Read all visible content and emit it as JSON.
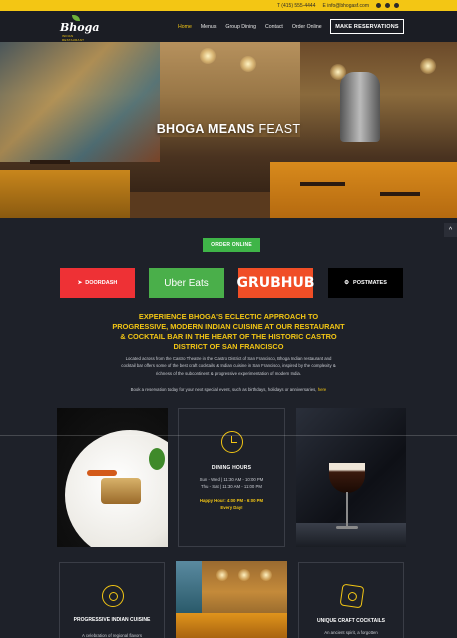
{
  "topbar": {
    "phone": "T (415) 555-4444",
    "email": "E info@bhogasf.com",
    "social_icons": [
      "facebook-icon",
      "instagram-icon",
      "yelp-icon"
    ]
  },
  "nav": {
    "logo_text": "Bhoga",
    "logo_tagline": "INDIAN RESTAURANT",
    "menu": [
      "Home",
      "Menus",
      "Group Dining",
      "Contact",
      "Order Online"
    ],
    "active_item": "Home",
    "reserve_label": "MAKE RESERVATIONS"
  },
  "hero": {
    "title_bold": "BHOGA MEANS",
    "title_light": "FEAST"
  },
  "order_online_label": "ORDER ONLINE",
  "scroll_top_icon": "chevron-up-icon",
  "delivery": {
    "doordash": "DOORDASH",
    "ubereats": "Uber Eats",
    "grubhub": "GRUBHUB",
    "postmates": "POSTMATES"
  },
  "intro": {
    "heading": "EXPERIENCE BHOGA'S ECLECTIC APPROACH TO PROGRESSIVE, MODERN INDIAN CUISINE AT OUR RESTAURANT & COCKTAIL BAR IN THE HEART OF THE HISTORIC CASTRO DISTRICT OF SAN FRANCISCO",
    "body": "Located across from the Castro Theatre in the Castro District of San Francisco, Bhoga Indian restaurant and cocktail bar offers some of the best craft cocktails & Indian cuisine in San Francisco, inspired by the complexity & richness of the subcontinent & progressive experimentation of modern India.",
    "book_text": "Book a reservation today for your next special event, such as birthdays, holidays or anniversaries,",
    "book_link": "here"
  },
  "hours": {
    "title": "DINING HOURS",
    "line1": "Sun - Wed | 11:30 AM - 10:00 PM",
    "line2": "Thu - Sat | 11:30 AM - 11:00 PM",
    "happy1": "Happy Hour: 4:00 PM - 6:00 PM",
    "happy2": "Every Day!"
  },
  "cards": {
    "cuisine_title": "PROGRESSIVE INDIAN CUISINE",
    "cuisine_text": "A celebration of regional flavors",
    "cocktails_title": "UNIQUE CRAFT COCKTAILS",
    "cocktails_text": "An ancient spirit, a forgotten"
  },
  "colors": {
    "accent": "#f3c614",
    "background": "#1e2129",
    "doordash": "#ee3135",
    "ubereats": "#4aaf4a",
    "grubhub": "#f04e26",
    "order_online": "#3fb548"
  }
}
